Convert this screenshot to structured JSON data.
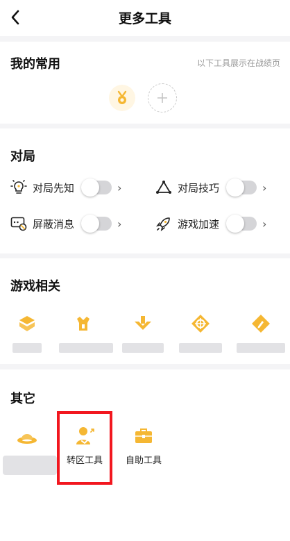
{
  "header": {
    "title": "更多工具",
    "back_icon": "chevron-left-icon"
  },
  "favorites": {
    "title": "我的常用",
    "hint": "以下工具展示在战绩页",
    "items": [
      {
        "icon": "medal-icon"
      }
    ],
    "add_icon": "plus-icon"
  },
  "match": {
    "title": "对局",
    "toggles": [
      {
        "label": "对局先知",
        "icon": "lightbulb-icon",
        "on": false
      },
      {
        "label": "对局技巧",
        "icon": "triangle-nodes-icon",
        "on": false
      },
      {
        "label": "屏蔽消息",
        "icon": "message-block-icon",
        "on": false
      },
      {
        "label": "游戏加速",
        "icon": "rocket-icon",
        "on": false
      }
    ]
  },
  "game": {
    "title": "游戏相关",
    "tools": [
      {
        "icon": "cube-icon"
      },
      {
        "icon": "rune-icon"
      },
      {
        "icon": "download-icon"
      },
      {
        "icon": "compass-icon"
      },
      {
        "icon": "edit-icon"
      }
    ]
  },
  "other": {
    "title": "其它",
    "tools": [
      {
        "label": "",
        "icon": "saucer-icon"
      },
      {
        "label": "转区工具",
        "icon": "transfer-user-icon"
      },
      {
        "label": "自助工具",
        "icon": "toolbox-icon"
      }
    ]
  },
  "colors": {
    "accent": "#f5b733",
    "highlight": "#f2171f"
  }
}
